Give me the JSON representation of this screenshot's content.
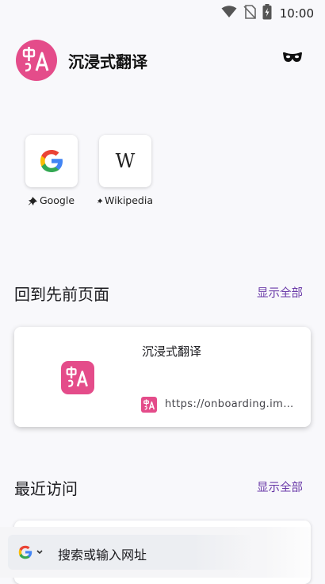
{
  "status_bar": {
    "time": "10:00"
  },
  "header": {
    "app_title": "沉浸式翻译",
    "logo_icon": "immersive-translate-logo"
  },
  "shortcuts": [
    {
      "label": "Google",
      "icon": "google-g-icon"
    },
    {
      "label": "Wikipedia",
      "icon": "wikipedia-w-icon"
    }
  ],
  "jump_back": {
    "title": "回到先前页面",
    "show_all": "显示全部",
    "card": {
      "title": "沉浸式翻译",
      "url": "https://onboarding.immersivetranslate.com"
    }
  },
  "recent": {
    "title": "最近访问",
    "show_all": "显示全部"
  },
  "search_bar": {
    "placeholder": "搜索或输入网址",
    "engine": "Google"
  },
  "colors": {
    "brand_pink": "#e44c8a",
    "link_purple": "#6a3aa8"
  }
}
